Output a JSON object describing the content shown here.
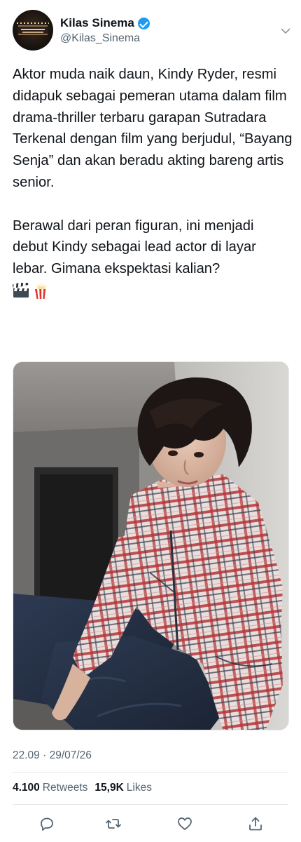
{
  "author": {
    "display_name": "Kilas Sinema",
    "handle": "@Kilas_Sinema",
    "verified": true,
    "avatar_icon": "cinema-marquee-avatar"
  },
  "tweet": {
    "paragraph_1": "Aktor muda naik daun, Kindy Ryder, resmi didapuk sebagai pemeran utama dalam film drama-thriller terbaru garapan Sutradara Terkenal dengan film yang berjudul, “Bayang Senja” dan akan beradu akting bareng artis senior.",
    "paragraph_2": "Berawal dari peran figuran, ini menjadi debut Kindy sebagai lead actor di layar lebar. Gimana ekspektasi kalian?",
    "emojis": [
      "clapper-board-icon",
      "popcorn-icon"
    ]
  },
  "media": {
    "type": "photo",
    "subject": "young man in plaid jacket leaning against wall"
  },
  "meta": {
    "time": "22.09",
    "date": "29/07/26",
    "separator": " · "
  },
  "stats": {
    "retweets_count": "4.100",
    "retweets_label": "Retweets",
    "likes_count": "15,9K",
    "likes_label": "Likes"
  },
  "actions": [
    "reply-icon",
    "retweet-icon",
    "like-icon",
    "share-icon"
  ],
  "colors": {
    "text": "#0f1419",
    "secondary": "#536471",
    "verified": "#1d9bf0",
    "divider": "#e6e9eb"
  }
}
